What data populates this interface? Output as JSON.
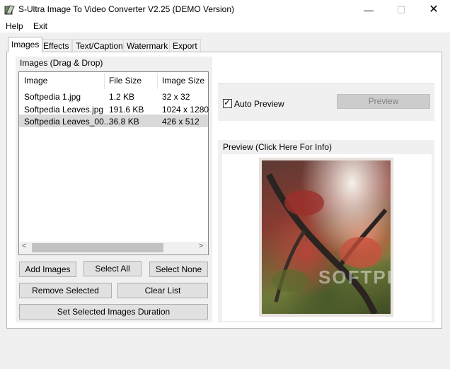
{
  "window": {
    "title": "S-Ultra Image To Video Converter V2.25 (DEMO Version)",
    "controls": {
      "minimize": "—",
      "maximize": "☐",
      "close": "✕"
    }
  },
  "menu": {
    "help": "Help",
    "exit": "Exit"
  },
  "tabs": [
    {
      "label": "Images",
      "active": true
    },
    {
      "label": "Effects"
    },
    {
      "label": "Text/Caption"
    },
    {
      "label": "Watermark"
    },
    {
      "label": "Export"
    }
  ],
  "images_group": {
    "label": "Images (Drag & Drop)",
    "columns": [
      "Image",
      "File Size",
      "Image Size"
    ],
    "rows": [
      {
        "name": "Softpedia 1.jpg",
        "size": "1.2 KB",
        "dims": "32 x 32"
      },
      {
        "name": "Softpedia Leaves.jpg",
        "size": "191.6 KB",
        "dims": "1024 x 1280"
      },
      {
        "name": "Softpedia Leaves_00...",
        "size": "36.8 KB",
        "dims": "426 x 512",
        "selected": true
      }
    ],
    "scroll_left": "<",
    "scroll_right": ">"
  },
  "buttons": {
    "add": "Add Images",
    "select_all": "Select All",
    "select_none": "Select None",
    "remove": "Remove Selected",
    "clear": "Clear List",
    "duration": "Set Selected Images Duration"
  },
  "preview_options": {
    "auto_preview_label": "Auto Preview",
    "auto_preview_checked": true,
    "checkmark": "✓",
    "preview_button": "Preview"
  },
  "preview_group": {
    "label": "Preview  (Click Here For Info)"
  },
  "watermark_overlay": "SOFTPEDIA"
}
